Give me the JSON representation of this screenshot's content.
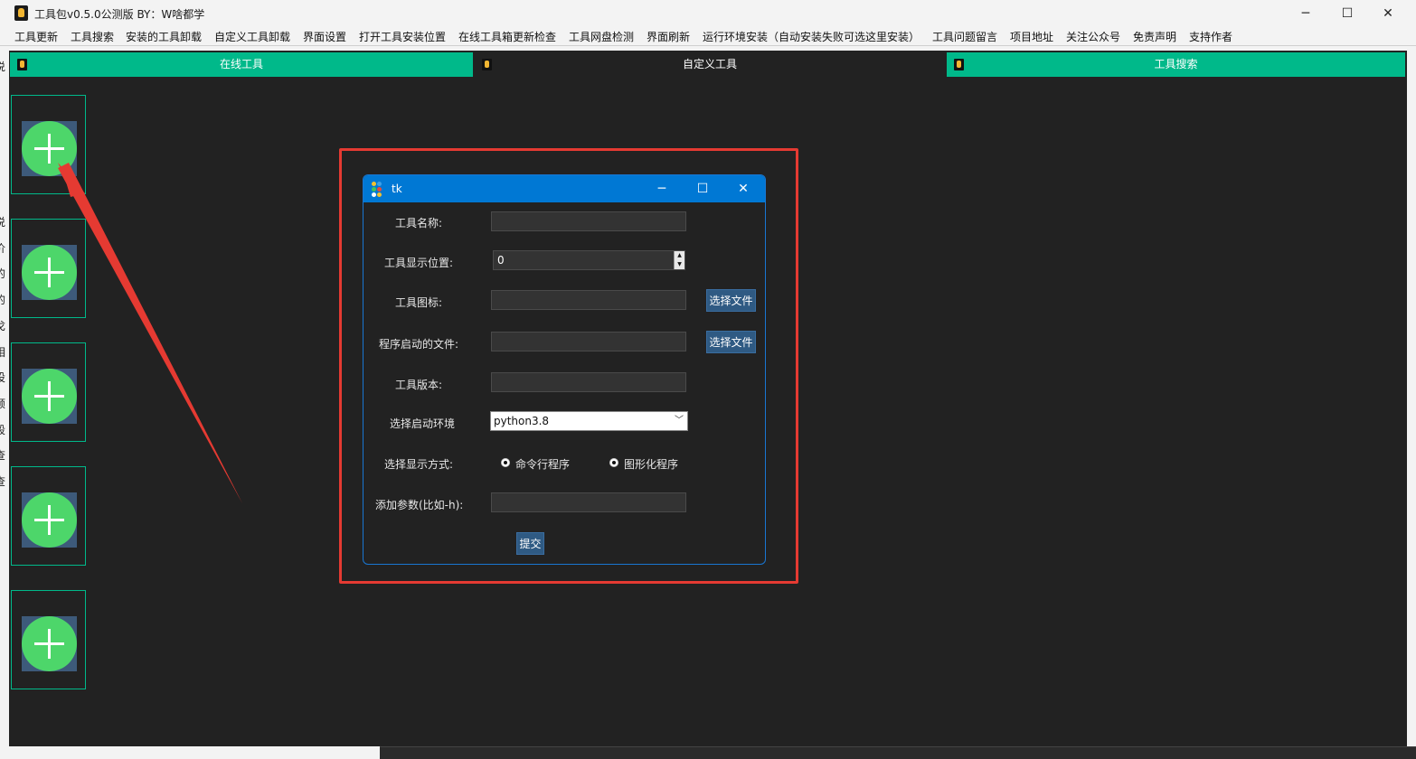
{
  "window": {
    "title": "工具包v0.5.0公测版  BY：W啥都学",
    "minimize_glyph": "─",
    "maximize_glyph": "☐",
    "close_glyph": "✕"
  },
  "menu": [
    "工具更新",
    "工具搜索",
    "安装的工具卸载",
    "自定义工具卸载",
    "界面设置",
    "打开工具安装位置",
    "在线工具箱更新检查",
    "工具网盘检测",
    "界面刷新",
    "运行环境安装（自动安装失败可选这里安装）",
    "工具问题留言",
    "项目地址",
    "关注公众号",
    "免责声明",
    "支持作者"
  ],
  "tabs": [
    {
      "label": "在线工具"
    },
    {
      "label": "自定义工具"
    },
    {
      "label": "工具搜索"
    }
  ],
  "left_strip_chars": [
    "说",
    "说",
    "价",
    "的",
    "的",
    "戈",
    "相",
    "设",
    "倾",
    "段",
    "查",
    "查"
  ],
  "add_cards": [
    {
      "icon": "plus-circle-icon"
    },
    {
      "icon": "plus-circle-icon"
    },
    {
      "icon": "plus-circle-icon"
    },
    {
      "icon": "plus-circle-icon"
    },
    {
      "icon": "plus-circle-icon"
    }
  ],
  "dialog": {
    "title": "tk",
    "minimize_glyph": "─",
    "maximize_glyph": "☐",
    "close_glyph": "✕",
    "name_label": "工具名称:",
    "name_value": "",
    "position_label": "工具显示位置:",
    "position_value": "0",
    "icon_label": "工具图标:",
    "icon_value": "",
    "icon_button": "选择文件",
    "entry_label": "程序启动的文件:",
    "entry_value": "",
    "entry_button": "选择文件",
    "version_label": "工具版本:",
    "version_value": "",
    "env_label": "选择启动环境",
    "env_value": "python3.8",
    "display_label": "选择显示方式:",
    "display_cli": "命令行程序",
    "display_gui": "图形化程序",
    "args_label": "添加参数(比如-h):",
    "args_value": "",
    "submit": "提交"
  },
  "colors": {
    "accent_green": "#00b98a",
    "plus_green": "#4dd66a",
    "dialog_blue": "#0078d4",
    "button_blue": "#2f5a83",
    "highlight_red": "#e53a32",
    "dark_bg": "#222222"
  }
}
